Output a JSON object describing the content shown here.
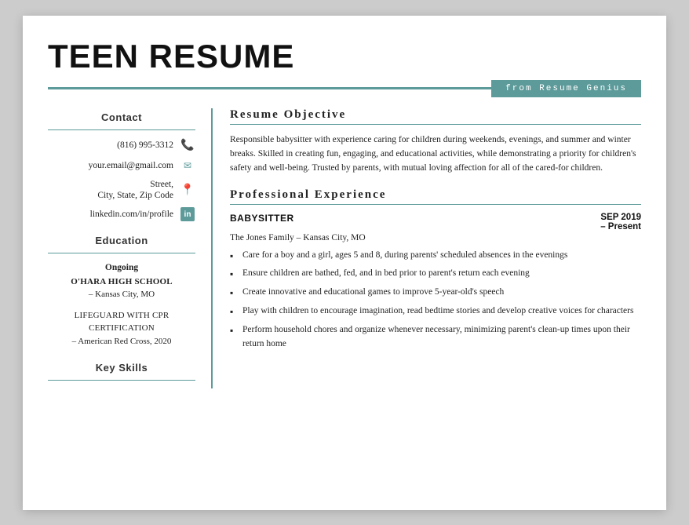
{
  "header": {
    "title": "TEEN RESUME",
    "badge": "from Resume Genius"
  },
  "sidebar": {
    "contact": {
      "label": "Contact",
      "phone": "(816) 995-3312",
      "email": "your.email@gmail.com",
      "address": "Street,\nCity, State, Zip Code",
      "linkedin": "linkedin.com/in/profile",
      "linkedin_icon": "in"
    },
    "education": {
      "label": "Education",
      "entries": [
        {
          "status": "Ongoing",
          "school": "O'HARA HIGH SCHOOL",
          "location": "– Kansas City, MO"
        },
        {
          "cert": "LIFEGUARD WITH CPR\nCERTIFICATION",
          "org": "– American Red Cross, 2020"
        }
      ]
    },
    "key_skills": {
      "label": "Key Skills"
    }
  },
  "main": {
    "objective": {
      "label": "Resume Objective",
      "text": "Responsible babysitter with experience caring for children during weekends, evenings, and summer and winter breaks. Skilled in creating fun, engaging, and educational activities, while demonstrating a priority for children's safety and well-being. Trusted by parents, with mutual loving affection for all of the cared-for children."
    },
    "experience": {
      "label": "Professional Experience",
      "jobs": [
        {
          "title": "BABYSITTER",
          "date_start": "SEP 2019",
          "date_end": "– Present",
          "company": "The Jones Family – Kansas City, MO",
          "bullets": [
            "Care for a boy and a girl, ages 5 and 8, during parents' scheduled absences in the evenings",
            "Ensure children are bathed, fed, and in bed prior to parent's return each evening",
            "Create innovative and educational games to improve 5-year-old's speech",
            "Play with children to encourage imagination, read bedtime stories and develop creative voices for characters",
            "Perform household chores and organize whenever necessary, minimizing parent's clean-up times upon their return home"
          ]
        }
      ]
    }
  }
}
